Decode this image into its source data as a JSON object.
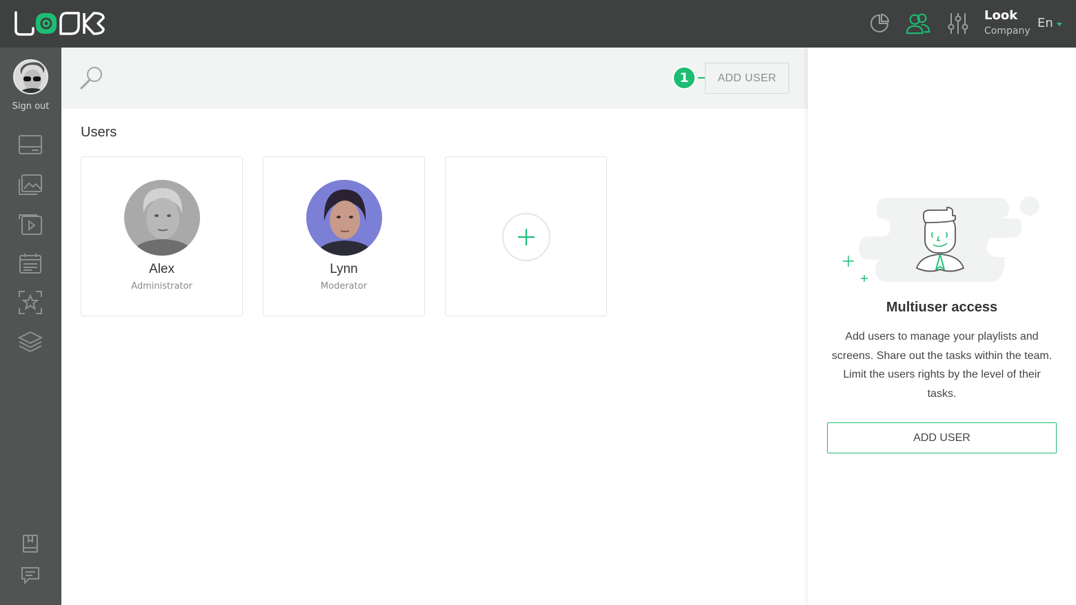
{
  "header": {
    "logo_text": "LOOK",
    "account": {
      "name": "Look",
      "company": "Company"
    },
    "language": "En",
    "icons": [
      "analytics-icon",
      "users-icon",
      "settings-sliders-icon"
    ]
  },
  "sidebar": {
    "signout_label": "Sign out",
    "items": [
      "screens-icon",
      "images-icon",
      "video-icon",
      "schedule-icon",
      "favorites-icon",
      "layers-icon"
    ],
    "bottom_items": [
      "docs-icon",
      "chat-icon"
    ]
  },
  "toolbar": {
    "step_number": "1",
    "add_user_label": "ADD USER"
  },
  "users_section": {
    "title": "Users",
    "users": [
      {
        "name": "Alex",
        "role": "Administrator"
      },
      {
        "name": "Lynn",
        "role": "Moderator"
      }
    ]
  },
  "info_panel": {
    "title": "Multiuser access",
    "description": "Add users to manage your playlists and screens. Share out the tasks within the team. Limit the users rights by the level of their tasks.",
    "button_label": "ADD USER"
  },
  "colors": {
    "accent": "#1dbd74",
    "topbar": "#3e4140",
    "sidebar": "#505554"
  }
}
